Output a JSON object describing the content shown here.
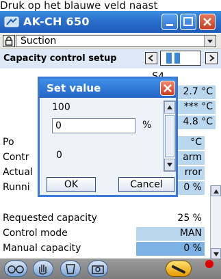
{
  "caption": "Druk op het blauwe veld naast",
  "window": {
    "title": "AK-CH 650",
    "controls": {
      "minimize": "_",
      "maximize": "□",
      "close": "✕"
    }
  },
  "menubar": {
    "selected": "Suction"
  },
  "header": {
    "title": "Capacity control setup",
    "nav_prev": "◀",
    "nav_next": "▶"
  },
  "rows": [
    {
      "label": "",
      "value": "S4"
    },
    {
      "label": "",
      "value": "2.7 °C"
    },
    {
      "label": "",
      "value": "*** °C"
    },
    {
      "label": "",
      "value": "4.8 °C"
    },
    {
      "label": "Po",
      "value": "°C"
    },
    {
      "label": "Contr",
      "value": "arm"
    },
    {
      "label": "Actual",
      "value": "rror"
    },
    {
      "label": "Runni",
      "value": "0 %"
    },
    {
      "label": "Requested capacity",
      "value": "25 %"
    },
    {
      "label": "Control mode",
      "value": "MAN"
    },
    {
      "label": "Manual capacity",
      "value": "0 %"
    }
  ],
  "dialog": {
    "title": "Set value",
    "max": "100",
    "input_value": "0",
    "unit": "%",
    "min": "0",
    "ok": "OK",
    "cancel": "Cancel"
  },
  "icons": [
    "lock-icon",
    "dropdown-arrow-icon",
    "scroll-up-icon",
    "scroll-down-icon",
    "glasses-icon",
    "hand-icon",
    "compressor-icon",
    "camera-icon",
    "wrench-icon",
    "alarm-icon"
  ]
}
